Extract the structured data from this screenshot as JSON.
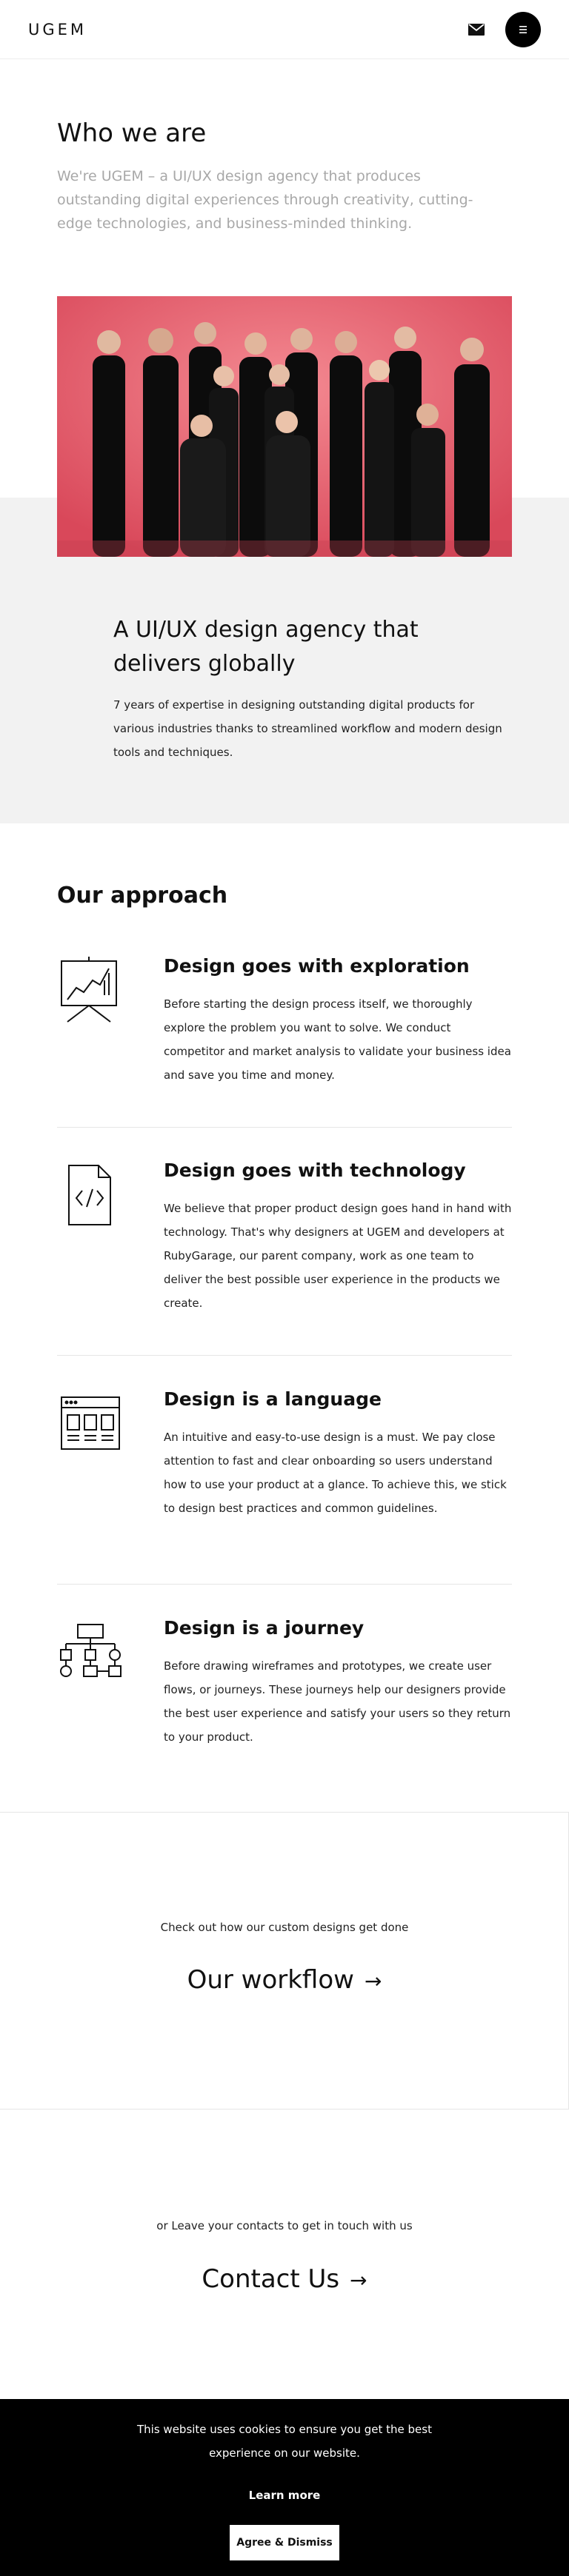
{
  "header": {
    "logo": "UGEM",
    "icons": {
      "mail": "mail-icon",
      "menu": "menu-icon"
    }
  },
  "hero": {
    "title": "Who we are",
    "subtitle": "We're UGEM – a UI/UX design agency that produces outstanding digital experiences through creativity, cutting-edge technologies, and business-minded thinking."
  },
  "band": {
    "title": "A UI/UX design agency that delivers globally",
    "text": "7 years of expertise in designing outstanding digital products for various industries thanks to streamlined workflow and modern design tools and techniques."
  },
  "approach": {
    "title": "Our approach",
    "items": [
      {
        "icon": "presentation-chart-icon",
        "title": "Design goes with exploration",
        "text": "Before starting the design process itself, we thoroughly explore the problem you want to solve. We conduct competitor and market analysis to validate your business idea and save you time and money."
      },
      {
        "icon": "code-file-icon",
        "title": "Design goes with technology",
        "text": "We believe that proper product design goes hand in hand with technology. That's why designers at UGEM and developers at RubyGarage, our parent company, work as one team to deliver the best possible user experience in the products we create."
      },
      {
        "icon": "browser-layout-icon",
        "title": "Design is a language",
        "text": "An intuitive and easy-to-use design is a must. We pay close attention to fast and clear onboarding so users understand how to use your product at a glance. To achieve this, we stick to design best practices and common guidelines."
      },
      {
        "icon": "flowchart-icon",
        "title": "Design is a journey",
        "text": "Before drawing wireframes and prototypes, we create user flows, or journeys. These journeys help our designers provide the best user experience and satisfy your users so they return to your product."
      }
    ]
  },
  "workflow": {
    "caption": "Check out how our custom designs get done",
    "link": "Our workflow",
    "arrow": "→"
  },
  "contact": {
    "caption": "or Leave your contacts to get in touch with us",
    "link": "Contact Us",
    "arrow": "→"
  },
  "cookie": {
    "text": "This website uses cookies to ensure you get the best experience on our website.",
    "learn_more": "Learn more",
    "agree": "Agree & Dismiss"
  },
  "colors": {
    "photo_bg": "#e8616d",
    "band_bg": "#f2f2f2",
    "cookie_bg": "#000000"
  }
}
